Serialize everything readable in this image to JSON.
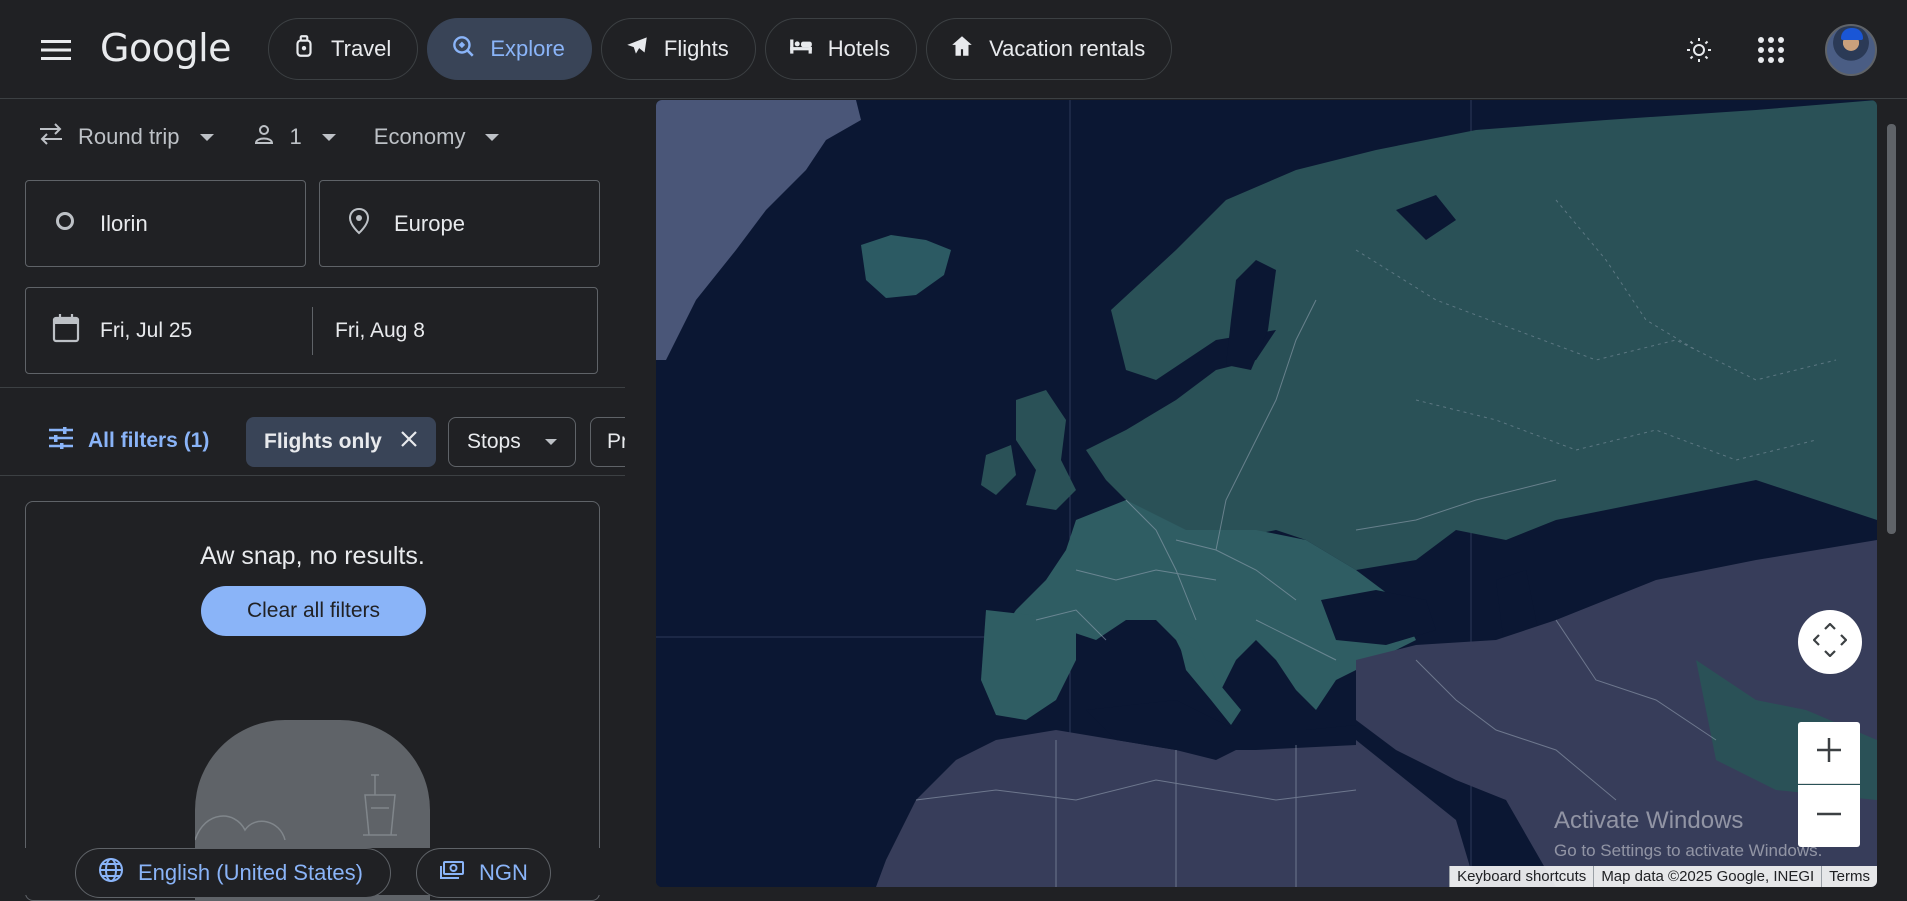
{
  "header": {
    "logo": "Google",
    "nav": [
      {
        "label": "Travel",
        "icon": "travel-tag-icon",
        "active": false
      },
      {
        "label": "Explore",
        "icon": "explore-icon",
        "active": true
      },
      {
        "label": "Flights",
        "icon": "flight-icon",
        "active": false
      },
      {
        "label": "Hotels",
        "icon": "bed-icon",
        "active": false
      },
      {
        "label": "Vacation rentals",
        "icon": "house-icon",
        "active": false
      }
    ]
  },
  "search": {
    "trip_type": "Round trip",
    "passengers": "1",
    "cabin": "Economy",
    "origin": "Ilorin",
    "destination": "Europe",
    "depart_date": "Fri, Jul 25",
    "return_date": "Fri, Aug 8"
  },
  "filters": {
    "all_filters": "All filters (1)",
    "flights_only": "Flights only",
    "stops": "Stops",
    "price_partial": "Pr"
  },
  "results": {
    "message": "Aw snap, no results.",
    "clear_button": "Clear all filters"
  },
  "footer": {
    "language": "English (United States)",
    "currency": "NGN"
  },
  "map": {
    "watermark_title": "Activate Windows",
    "watermark_sub": "Go to Settings to activate Windows.",
    "attribution": {
      "shortcuts": "Keyboard shortcuts",
      "data": "Map data ©2025 Google, INEGI",
      "terms": "Terms"
    }
  },
  "colors": {
    "background": "#202124",
    "accent": "#8ab4f8",
    "active_chip": "#394457",
    "ocean": "#0b1733",
    "land": "#2a4f57"
  }
}
